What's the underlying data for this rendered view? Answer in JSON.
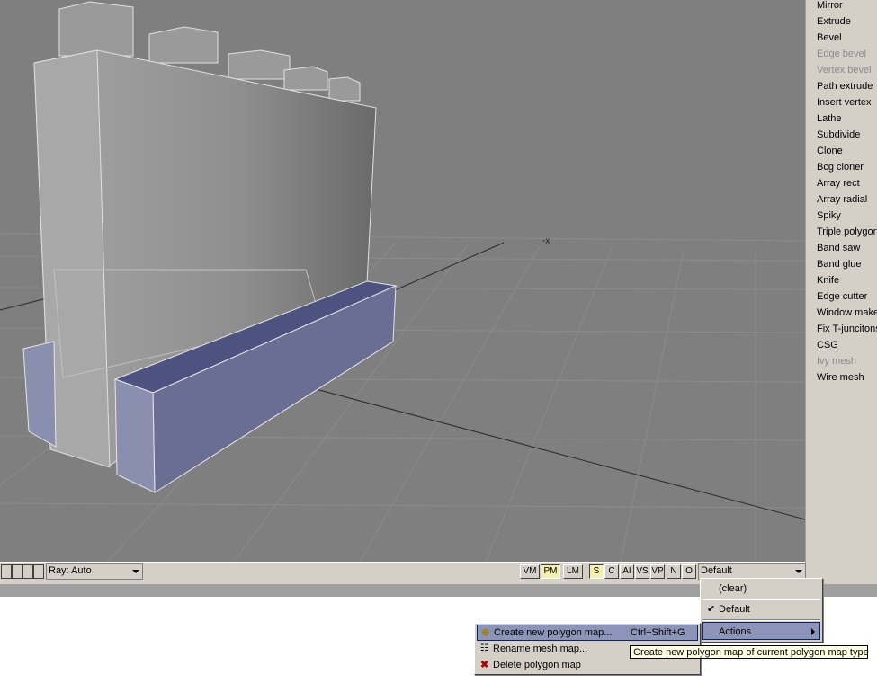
{
  "tools": [
    {
      "label": "Mirror",
      "enabled": true
    },
    {
      "label": "Extrude",
      "enabled": true
    },
    {
      "label": "Bevel",
      "enabled": true
    },
    {
      "label": "Edge bevel",
      "enabled": false
    },
    {
      "label": "Vertex bevel",
      "enabled": false
    },
    {
      "label": "Path extrude",
      "enabled": true
    },
    {
      "label": "Insert vertex",
      "enabled": true
    },
    {
      "label": "Lathe",
      "enabled": true
    },
    {
      "label": "Subdivide",
      "enabled": true
    },
    {
      "label": "Clone",
      "enabled": true
    },
    {
      "label": "Bcg cloner",
      "enabled": true
    },
    {
      "label": "Array rect",
      "enabled": true
    },
    {
      "label": "Array radial",
      "enabled": true
    },
    {
      "label": "Spiky",
      "enabled": true
    },
    {
      "label": "Triple polygon",
      "enabled": true
    },
    {
      "label": "Band saw",
      "enabled": true
    },
    {
      "label": "Band glue",
      "enabled": true
    },
    {
      "label": "Knife",
      "enabled": true
    },
    {
      "label": "Edge cutter",
      "enabled": true
    },
    {
      "label": "Window maker",
      "enabled": true
    },
    {
      "label": "Fix T-juncitons",
      "enabled": true
    },
    {
      "label": "CSG",
      "enabled": true
    },
    {
      "label": "Ivy mesh",
      "enabled": false
    },
    {
      "label": "Wire mesh",
      "enabled": true
    }
  ],
  "viewport": {
    "cursor_marker": "-x"
  },
  "bottom_bar": {
    "ray_label": "Ray: Auto",
    "map_modes": [
      "VM",
      "PM",
      "LM"
    ],
    "active_map_mode": "PM",
    "flags": [
      "S",
      "C",
      "AI",
      "VS",
      "VP",
      "N",
      "O"
    ],
    "active_flag": "S",
    "polygon_map_value": "Default"
  },
  "map_menu": {
    "items": [
      "(clear)",
      "Default"
    ],
    "checked": "Default",
    "actions_label": "Actions"
  },
  "actions_menu": {
    "create": {
      "label": "Create new polygon map...",
      "shortcut": "Ctrl+Shift+G",
      "icon": "plus-icon"
    },
    "rename": {
      "label": "Rename mesh map...",
      "icon": "list-icon"
    },
    "delete": {
      "label": "Delete polygon map",
      "icon": "delete-x-icon"
    }
  },
  "tooltip": "Create new polygon map of current polygon map type",
  "colors": {
    "viewport_bg": "#7f7f7f",
    "panel_bg": "#d4d0c8",
    "highlight": "#8c95b8",
    "selected_poly": "#686c90",
    "tooltip_bg": "#ffffe1"
  }
}
